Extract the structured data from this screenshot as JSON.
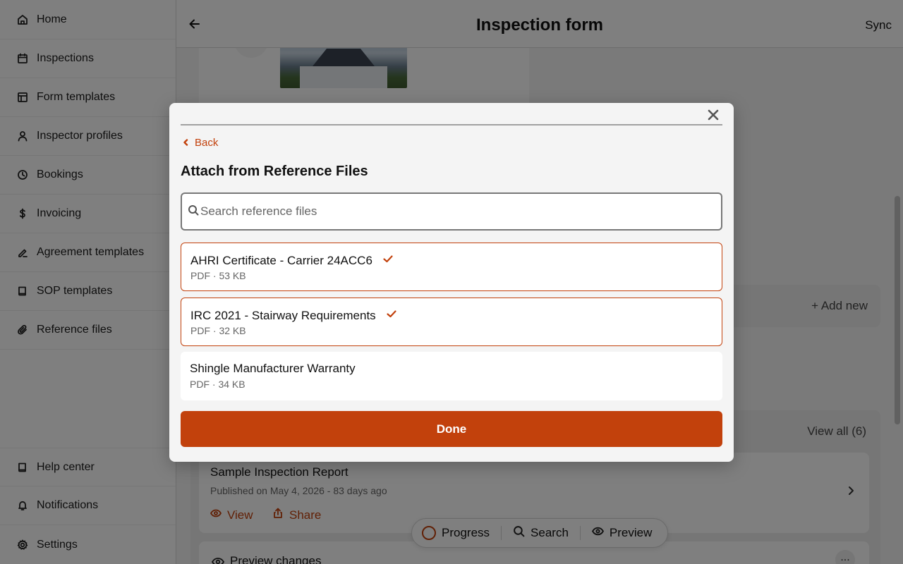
{
  "sidebar": {
    "items": [
      {
        "label": "Home",
        "icon": "home-icon"
      },
      {
        "label": "Inspections",
        "icon": "calendar-icon"
      },
      {
        "label": "Form templates",
        "icon": "layout-icon"
      },
      {
        "label": "Inspector profiles",
        "icon": "user-icon"
      },
      {
        "label": "Bookings",
        "icon": "clock-icon"
      },
      {
        "label": "Invoicing",
        "icon": "dollar-icon"
      },
      {
        "label": "Agreement templates",
        "icon": "signature-icon"
      },
      {
        "label": "SOP templates",
        "icon": "book-icon"
      },
      {
        "label": "Reference files",
        "icon": "paperclip-icon"
      }
    ],
    "bottom_items": [
      {
        "label": "Help center",
        "icon": "book-icon"
      },
      {
        "label": "Notifications",
        "icon": "bell-icon"
      },
      {
        "label": "Settings",
        "icon": "gear-icon"
      }
    ]
  },
  "header": {
    "title": "Inspection form",
    "sync_label": "Sync"
  },
  "background": {
    "add_new_label": "+ Add new",
    "view_all_label": "View all (6)",
    "report": {
      "title": "Sample Inspection Report",
      "subtitle": "Published on May 4, 2026 - 83 days ago",
      "view_label": "View",
      "share_label": "Share"
    },
    "preview_changes_label": "Preview changes",
    "more_label": "..."
  },
  "floatbar": {
    "progress_label": "Progress",
    "search_label": "Search",
    "preview_label": "Preview"
  },
  "modal": {
    "back_label": "Back",
    "title": "Attach from Reference Files",
    "search_placeholder": "Search reference files",
    "files": [
      {
        "name": "AHRI Certificate - Carrier 24ACC6",
        "meta": "PDF · 53 KB",
        "selected": true
      },
      {
        "name": "IRC 2021 - Stairway Requirements",
        "meta": "PDF · 32 KB",
        "selected": true
      },
      {
        "name": "Shingle Manufacturer Warranty",
        "meta": "PDF · 34 KB",
        "selected": false
      }
    ],
    "done_label": "Done"
  },
  "colors": {
    "accent": "#c2410c",
    "overlay": "rgba(0,0,0,0.5)"
  }
}
